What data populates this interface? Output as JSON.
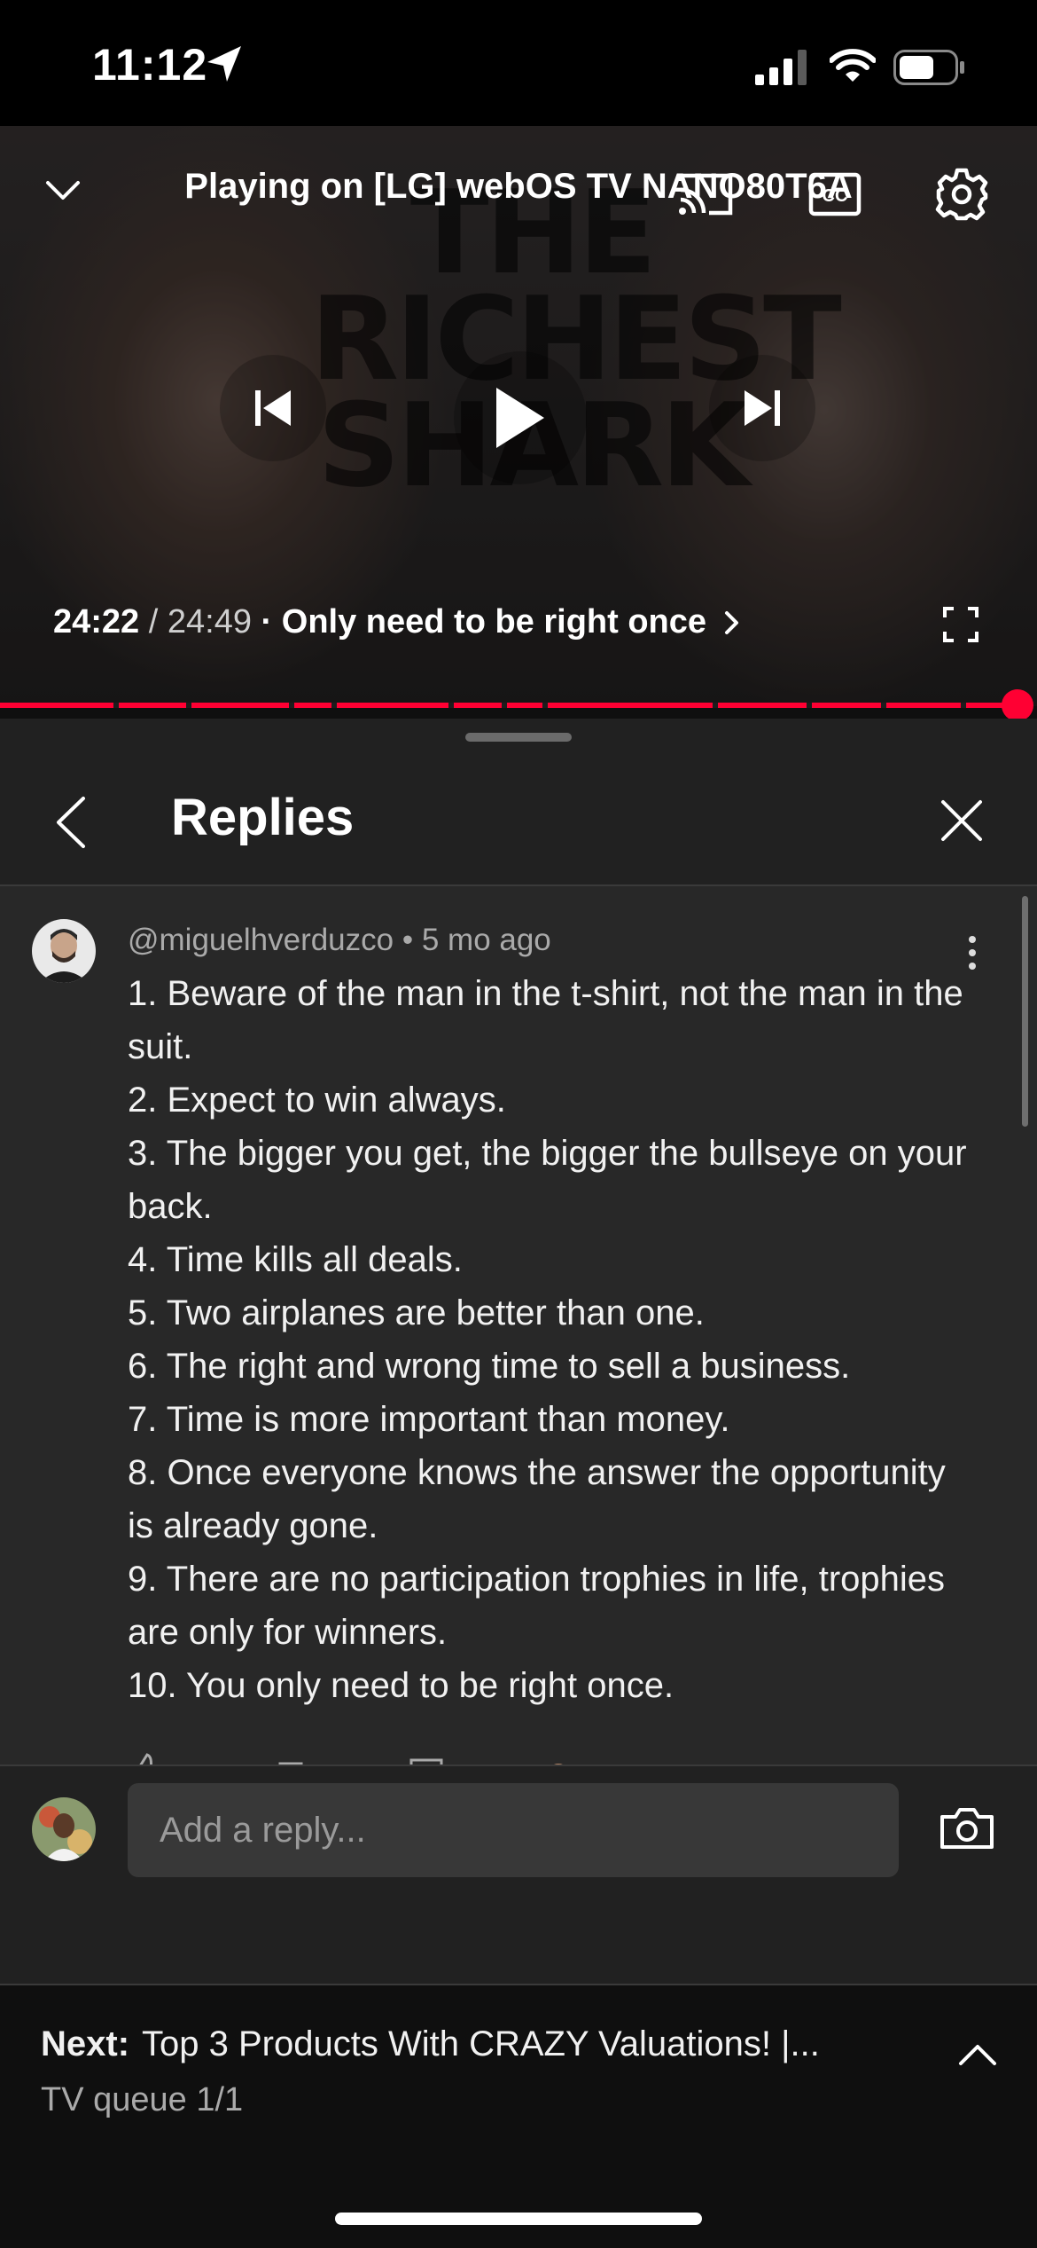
{
  "status_bar": {
    "time": "11:12"
  },
  "player": {
    "background_title": "THE RICHEST SHARK",
    "casting_text": "Playing on [LG] webOS TV NANO80T6A",
    "current_time": "24:22",
    "duration": "24:49",
    "chapter": "Only need to be right once",
    "progress": 0.982,
    "accent_color": "#ff0033"
  },
  "replies": {
    "title": "Replies",
    "comment": {
      "author": "@miguelhverduzco",
      "age": "5 mo ago",
      "lines": [
        "1. Beware of the man in the t-shirt, not the man in the suit.",
        "2. Expect to win always.",
        "3. The bigger you get, the bigger the bullseye on your back.",
        "4. Time kills all deals.",
        "5. Two airplanes are better than one.",
        "6. The right and wrong time to sell a business.",
        "7. Time is more important than money.",
        "8. Once everyone knows the answer the opportunity is already gone.",
        "9. There are no participation trophies in life, trophies are only for winners.",
        "10. You only need to be right once."
      ]
    },
    "reply_input": {
      "placeholder": "Add a reply..."
    }
  },
  "next_bar": {
    "label": "Next:",
    "title": "Top 3 Products With CRAZY Valuations! |...",
    "queue": "TV queue 1/1"
  }
}
